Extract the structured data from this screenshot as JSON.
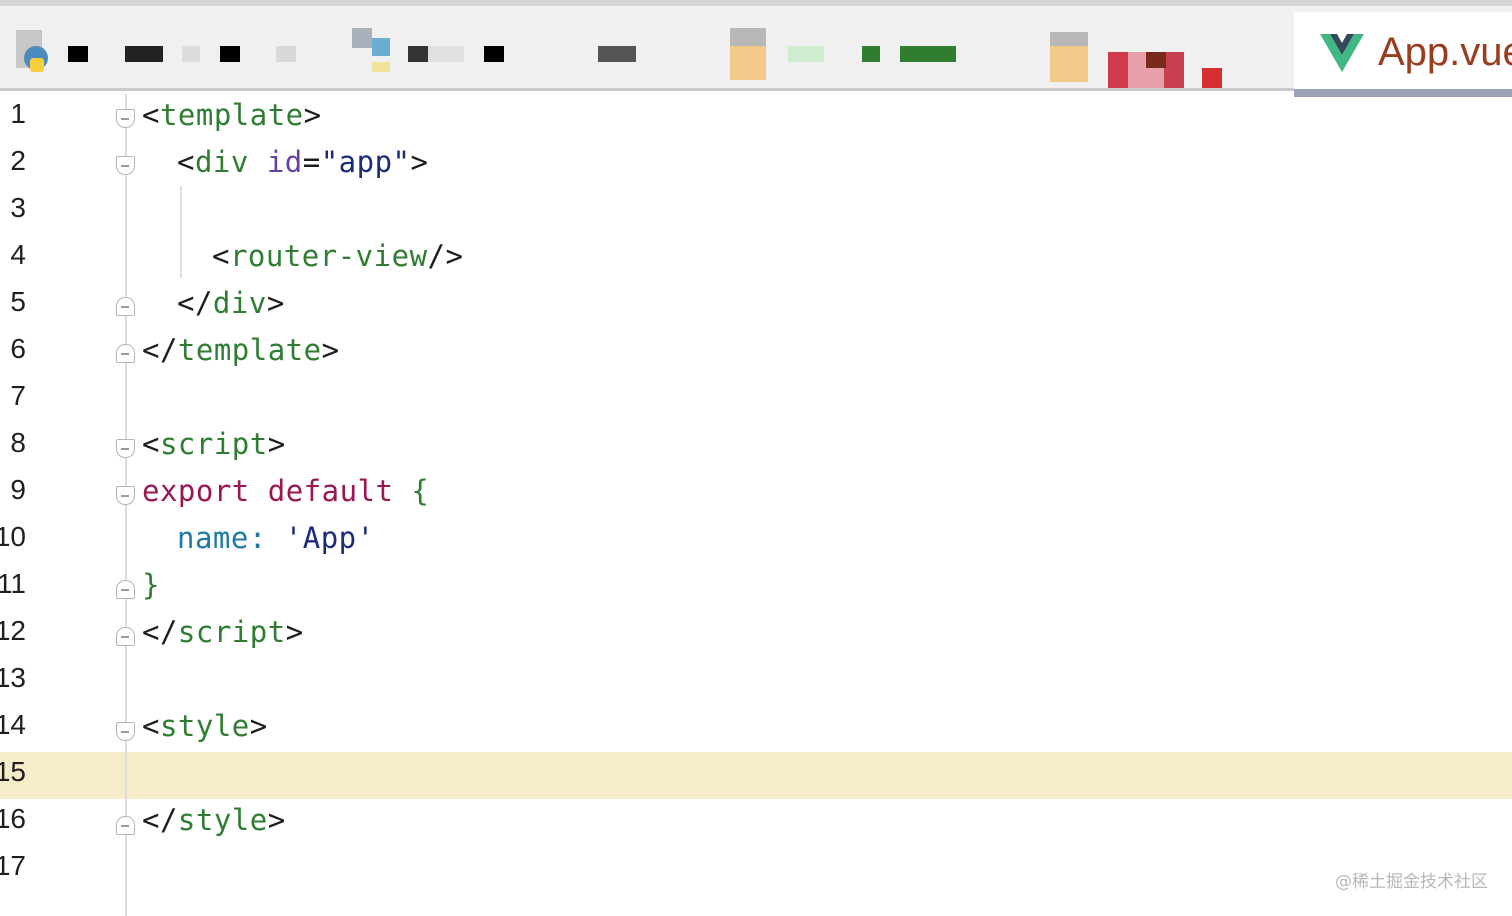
{
  "tabs": {
    "active": {
      "label": "App.vue",
      "icon": "vue-logo-icon"
    },
    "inactive_icons": [
      "python-file-icon",
      "file-icon",
      "file-icon",
      "file-icon"
    ]
  },
  "editor": {
    "current_line": 15,
    "lines": [
      {
        "num": "1"
      },
      {
        "num": "2"
      },
      {
        "num": "3"
      },
      {
        "num": "4"
      },
      {
        "num": "5"
      },
      {
        "num": "6"
      },
      {
        "num": "7"
      },
      {
        "num": "8"
      },
      {
        "num": "9"
      },
      {
        "num": "10"
      },
      {
        "num": "11"
      },
      {
        "num": "12"
      },
      {
        "num": "13"
      },
      {
        "num": "14"
      },
      {
        "num": "15"
      },
      {
        "num": "16"
      },
      {
        "num": "17"
      }
    ],
    "code": {
      "l1": {
        "open": "<",
        "name": "template",
        "close": ">"
      },
      "l2": {
        "open": "<",
        "name": "div",
        "attr": "id",
        "eq": "=",
        "value": "\"app\"",
        "close": ">"
      },
      "l4": {
        "open": "<",
        "name": "router-view",
        "close": "/>"
      },
      "l5": {
        "open": "</",
        "name": "div",
        "close": ">"
      },
      "l6": {
        "open": "</",
        "name": "template",
        "close": ">"
      },
      "l8": {
        "open": "<",
        "name": "script",
        "close": ">"
      },
      "l9": {
        "kw1": "export",
        "kw2": "default",
        "brace": "{"
      },
      "l10": {
        "prop": "name",
        "colon": ":",
        "value": "'App'"
      },
      "l11": {
        "brace": "}"
      },
      "l12": {
        "open": "</",
        "name": "script",
        "close": ">"
      },
      "l14": {
        "open": "<",
        "name": "style",
        "close": ">"
      },
      "l16": {
        "open": "</",
        "name": "style",
        "close": ">"
      }
    }
  },
  "watermark": "@稀土掘金技术社区",
  "colors": {
    "tag": "#2e7d32",
    "attr": "#6a3fa3",
    "string": "#1a2b7a",
    "keyword": "#9b1652",
    "property": "#1f7ba3",
    "current_line_bg": "#f6ecc7",
    "tab_label": "#9a3d1e",
    "vue_green": "#41b883",
    "vue_dark": "#35495e"
  }
}
